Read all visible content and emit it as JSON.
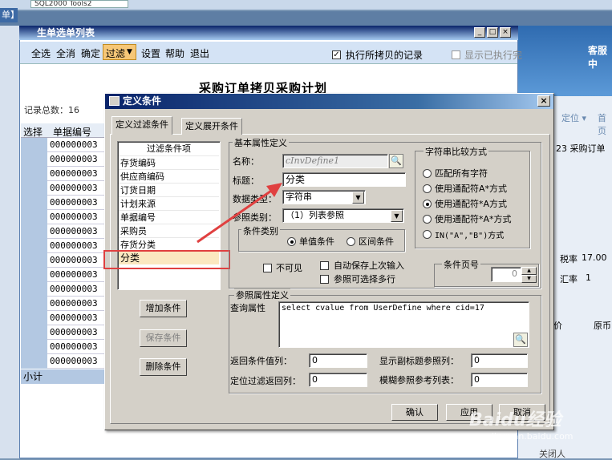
{
  "background": {
    "top_tab_label": "SQL2000 Tools2",
    "left_label": "单】",
    "right_header_label": "客服中",
    "right_col_top": [
      "定位 ▾",
      "首页"
    ],
    "right_labels": {
      "ref": "23 采购订单",
      "tax_rate_label": "税率",
      "tax_rate_value": "17.00",
      "exchange_label": "汇率",
      "exchange_value": "1",
      "price_label": "价",
      "original_label": "原币"
    },
    "bottom_right": "关闭人"
  },
  "list_window": {
    "title": "生单选单列表",
    "menu": [
      "全选",
      "全消",
      "确定",
      "过滤",
      "设置",
      "帮助",
      "退出"
    ],
    "filter_dropdown_arrow": "▼",
    "exec_checkbox_label": "执行所拷贝的记录",
    "show_checkbox_label": "显示已执行完",
    "window_buttons": [
      "_",
      "□",
      "×"
    ],
    "heading": "采购订单拷贝采购计划",
    "record_count": "记录总数：16",
    "columns": [
      "选择",
      "单据编号"
    ],
    "rows": [
      "000000003",
      "000000003",
      "000000003",
      "000000003",
      "000000003",
      "000000003",
      "000000003",
      "000000003",
      "000000003",
      "000000003",
      "000000003",
      "000000003",
      "000000003",
      "000000003",
      "000000003",
      "000000003"
    ],
    "subtotal": "小计"
  },
  "dialog": {
    "title": "定义条件",
    "close": "×",
    "tabs": [
      "定义过滤条件",
      "定义展开条件"
    ],
    "list_header": "过滤条件项",
    "conditions": [
      "存货编码",
      "供应商编码",
      "订货日期",
      "计划来源",
      "单据编号",
      "采购员",
      "存货分类",
      "分类"
    ],
    "selected_condition": "分类",
    "buttons": {
      "add": "增加条件",
      "save": "保存条件",
      "delete": "删除条件"
    },
    "basic_group": "基本属性定义",
    "name_label": "名称：",
    "name_value": "cInvDefine1",
    "title_label": "标题：",
    "title_value": "分类",
    "datatype_label": "数据类型：",
    "datatype_value": "字符串",
    "reftype_label": "参照类别：",
    "reftype_value": "（1）列表参照",
    "condtype_group": "条件类别",
    "condtype_options": [
      "单值条件",
      "区间条件"
    ],
    "compare_group": "字符串比较方式",
    "compare_options": [
      "匹配所有字符",
      "使用通配符A*方式",
      "使用通配符*A方式",
      "使用通配符*A*方式",
      "IN(\"A\",\"B\")方式"
    ],
    "compare_selected_index": 2,
    "invisible_label": "不可见",
    "autosave_label": "自动保存上次输入",
    "multiselect_label": "参照可选择多行",
    "page_group": "条件页号",
    "page_value": "0",
    "ref_group": "参照属性定义",
    "query_label": "查询属性",
    "query_value": "select cvalue from UserDefine  where cid=17",
    "return_col_label": "返回条件值列：",
    "return_col_value": "0",
    "show_sub_label": "显示副标题参照列：",
    "show_sub_value": "0",
    "locate_label": "定位过滤返回列：",
    "locate_value": "0",
    "fuzzy_label": "模糊参照参考列表：",
    "fuzzy_value": "0",
    "ok": "确认",
    "apply": "应用",
    "cancel": "取消"
  },
  "watermark": {
    "text": "Baidu经验",
    "sub": "jingyan.baidu.com"
  },
  "colors": {
    "annotation": "#e04040",
    "titlebar": "#0a246a",
    "highlight": "#fbe8c0"
  }
}
